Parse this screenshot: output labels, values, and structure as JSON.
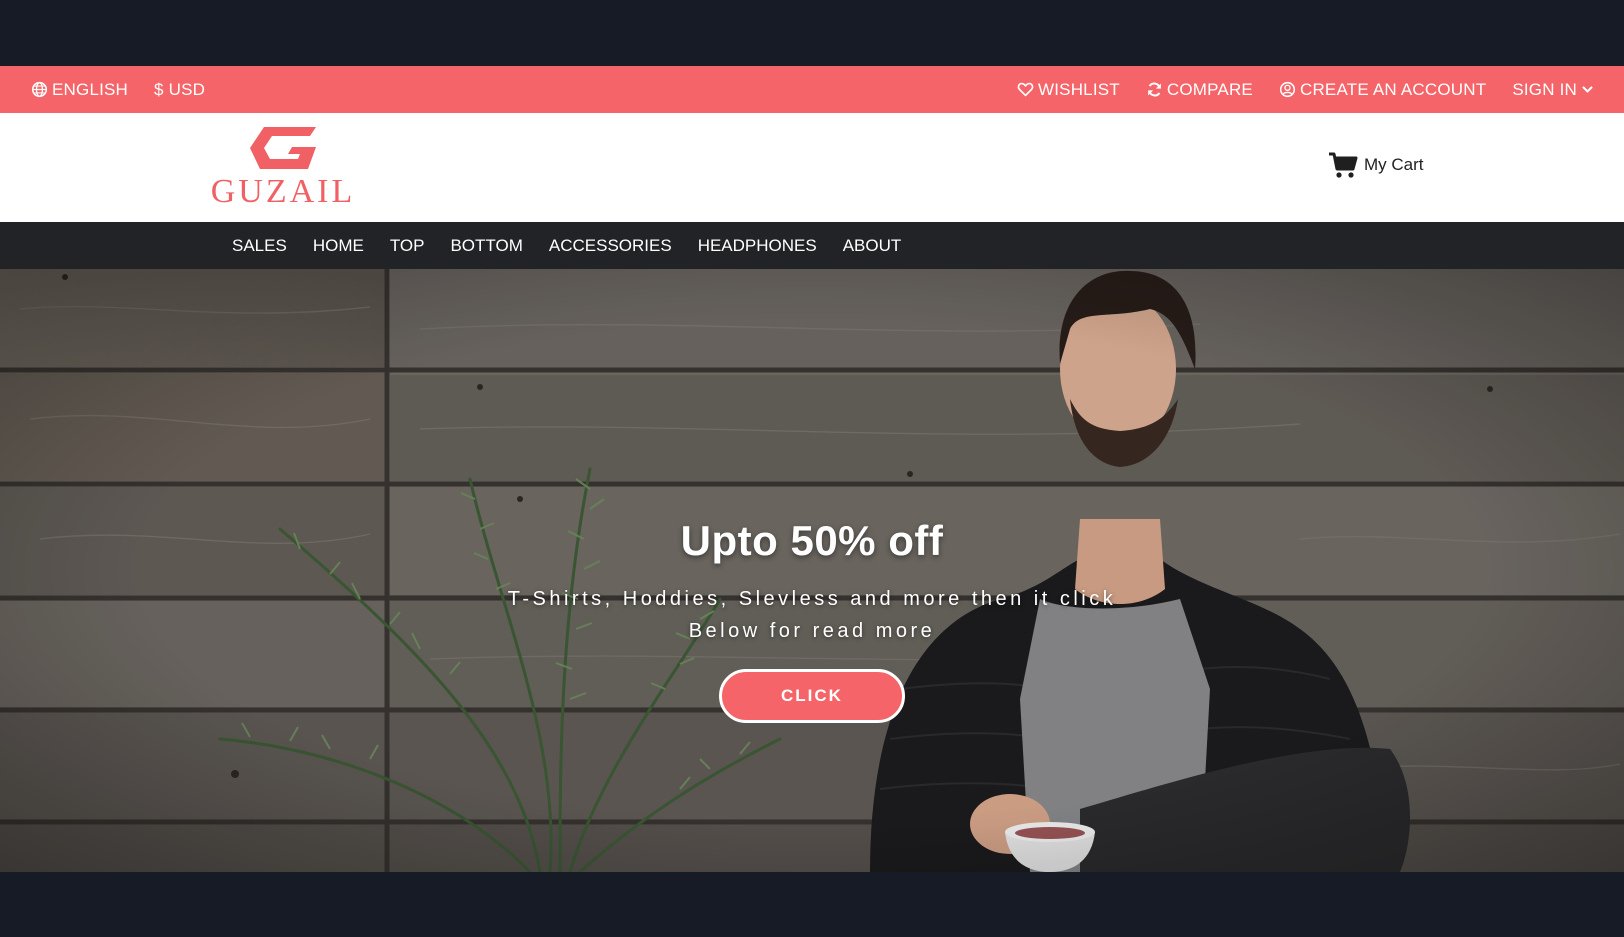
{
  "colors": {
    "accent": "#f56468",
    "nav_bg": "#212326",
    "frame": "#161b25"
  },
  "topbar": {
    "language": {
      "label": "ENGLISH",
      "icon": "globe-icon"
    },
    "currency": {
      "label": "$ USD"
    },
    "wishlist": {
      "label": "WISHLIST",
      "icon": "heart-icon"
    },
    "compare": {
      "label": "COMPARE",
      "icon": "refresh-icon"
    },
    "create_account": {
      "label": "CREATE AN ACCOUNT",
      "icon": "user-circle-icon"
    },
    "sign_in": {
      "label": "SIGN IN",
      "icon": "chevron-down-icon"
    }
  },
  "header": {
    "logo_text": "GUZAIL",
    "cart": {
      "label": "My Cart",
      "icon": "cart-icon"
    }
  },
  "nav": {
    "items": [
      "SALES",
      "HOME",
      "TOP",
      "BOTTOM",
      "ACCESSORIES",
      "HEADPHONES",
      "ABOUT"
    ]
  },
  "hero": {
    "title": "Upto 50% off",
    "subtitle": "T-Shirts, Hoddies, Slevless and more then it click Below for read more",
    "button_label": "CLICK"
  }
}
